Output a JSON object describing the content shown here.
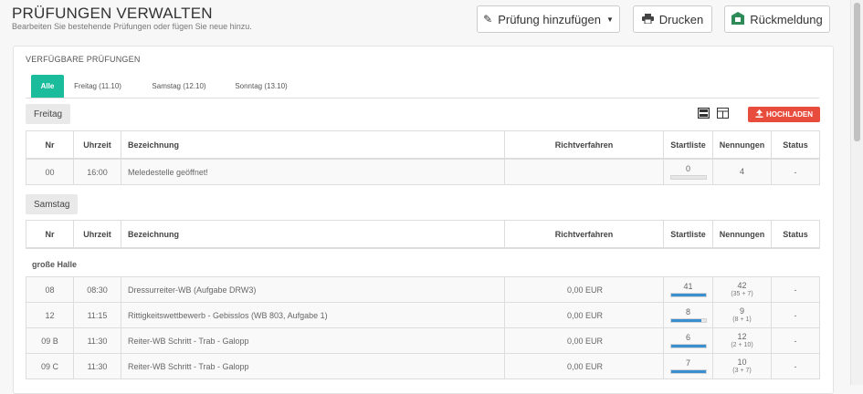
{
  "header": {
    "title": "PRÜFUNGEN VERWALTEN",
    "subtitle": "Bearbeiten Sie bestehende Prüfungen oder fügen Sie neue hinzu.",
    "buttons": {
      "add": "Prüfung hinzufügen",
      "print": "Drucken",
      "feedback": "Rückmeldung"
    }
  },
  "panel": {
    "title": "VERFÜGBARE PRÜFUNGEN",
    "tabs": [
      "Alle",
      "Freitag (11.10)",
      "Samstag (12.10)",
      "Sonntag (13.10)"
    ],
    "upload_label": "HOCHLADEN"
  },
  "columns": {
    "nr": "Nr",
    "time": "Uhrzeit",
    "name": "Bezeichnung",
    "fee": "Richtverfahren",
    "startlist": "Startliste",
    "entries": "Nennungen",
    "status": "Status"
  },
  "friday": {
    "label": "Freitag",
    "rows": [
      {
        "nr": "00",
        "time": "16:00",
        "name": "Meledestelle geöffnet!",
        "fee": "",
        "start": "0",
        "fill": 0,
        "entries": "4",
        "entries_sub": "",
        "status": "-"
      }
    ]
  },
  "saturday": {
    "label": "Samstag",
    "group": "große Halle",
    "rows": [
      {
        "nr": "08",
        "time": "08:30",
        "name": "Dressurreiter-WB (Aufgabe DRW3)",
        "fee": "0,00 EUR",
        "start": "41",
        "fill": 1.0,
        "entries": "42",
        "entries_sub": "(35 + 7)",
        "status": "-"
      },
      {
        "nr": "12",
        "time": "11:15",
        "name": "Rittigkeitswettbewerb - Gebisslos (WB 803, Aufgabe 1)",
        "fee": "0,00 EUR",
        "start": "8",
        "fill": 0.89,
        "entries": "9",
        "entries_sub": "(8 + 1)",
        "status": "-"
      },
      {
        "nr": "09 B",
        "time": "11:30",
        "name": "Reiter-WB Schritt - Trab - Galopp",
        "fee": "0,00 EUR",
        "start": "6",
        "fill": 1.0,
        "entries": "12",
        "entries_sub": "(2 + 10)",
        "status": "-"
      },
      {
        "nr": "09 C",
        "time": "11:30",
        "name": "Reiter-WB Schritt - Trab - Galopp",
        "fee": "0,00 EUR",
        "start": "7",
        "fill": 1.0,
        "entries": "10",
        "entries_sub": "(3 + 7)",
        "status": "-"
      }
    ]
  },
  "colors": {
    "accent": "#1abc9c",
    "upload": "#e74c3c",
    "bar": "#3a8fd1"
  }
}
